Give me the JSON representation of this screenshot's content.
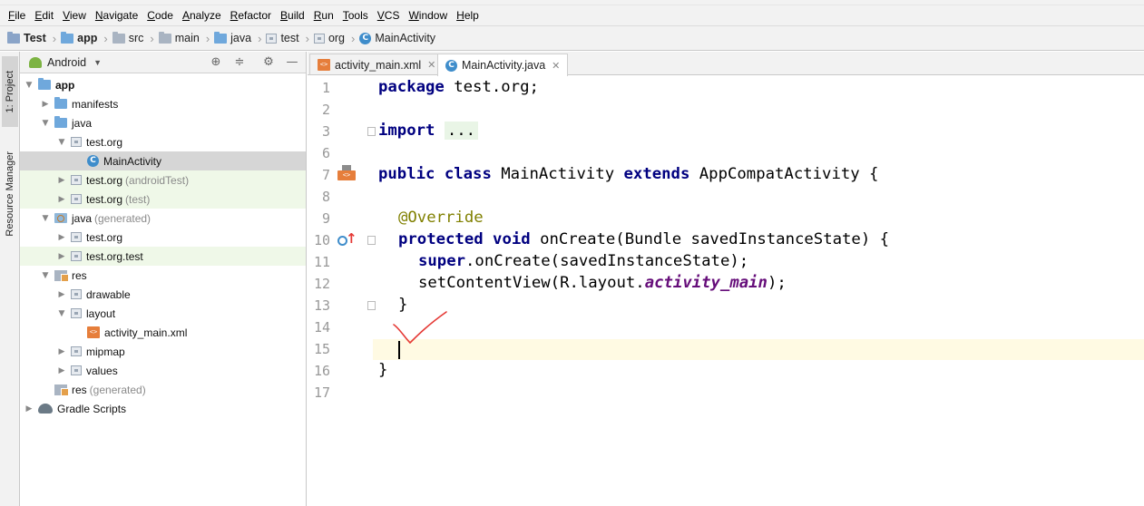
{
  "menu": [
    "File",
    "Edit",
    "View",
    "Navigate",
    "Code",
    "Analyze",
    "Refactor",
    "Build",
    "Run",
    "Tools",
    "VCS",
    "Window",
    "Help"
  ],
  "breadcrumb": [
    {
      "label": "Test",
      "icon": "project-folder-icon",
      "bold": true
    },
    {
      "label": "app",
      "icon": "module-folder-icon",
      "bold": true
    },
    {
      "label": "src",
      "icon": "folder-icon"
    },
    {
      "label": "main",
      "icon": "folder-icon"
    },
    {
      "label": "java",
      "icon": "source-folder-icon"
    },
    {
      "label": "test",
      "icon": "package-icon"
    },
    {
      "label": "org",
      "icon": "package-icon"
    },
    {
      "label": "MainActivity",
      "icon": "class-icon"
    }
  ],
  "side_tabs": {
    "project": "1: Project",
    "resources": "Resource Manager"
  },
  "project_panel": {
    "view_mode": "Android",
    "tree": [
      {
        "label": "app",
        "depth": 0,
        "arrow": "▼",
        "icon": "module",
        "bold": true
      },
      {
        "label": "manifests",
        "depth": 1,
        "arrow": "▶",
        "icon": "folder"
      },
      {
        "label": "java",
        "depth": 1,
        "arrow": "▼",
        "icon": "folder"
      },
      {
        "label": "test.org",
        "depth": 2,
        "arrow": "▼",
        "icon": "package"
      },
      {
        "label": "MainActivity",
        "depth": 3,
        "arrow": "",
        "icon": "class",
        "selected": true
      },
      {
        "label": "test.org",
        "suffix": "(androidTest)",
        "depth": 2,
        "arrow": "▶",
        "icon": "package",
        "green": true
      },
      {
        "label": "test.org",
        "suffix": "(test)",
        "depth": 2,
        "arrow": "▶",
        "icon": "package",
        "green": true
      },
      {
        "label": "java",
        "suffix": "(generated)",
        "depth": 1,
        "arrow": "▼",
        "icon": "generated"
      },
      {
        "label": "test.org",
        "depth": 2,
        "arrow": "▶",
        "icon": "package"
      },
      {
        "label": "test.org.test",
        "depth": 2,
        "arrow": "▶",
        "icon": "package",
        "green": true
      },
      {
        "label": "res",
        "depth": 1,
        "arrow": "▼",
        "icon": "res"
      },
      {
        "label": "drawable",
        "depth": 2,
        "arrow": "▶",
        "icon": "package"
      },
      {
        "label": "layout",
        "depth": 2,
        "arrow": "▼",
        "icon": "package"
      },
      {
        "label": "activity_main.xml",
        "depth": 3,
        "arrow": "",
        "icon": "xml"
      },
      {
        "label": "mipmap",
        "depth": 2,
        "arrow": "▶",
        "icon": "package"
      },
      {
        "label": "values",
        "depth": 2,
        "arrow": "▶",
        "icon": "package"
      },
      {
        "label": "res",
        "suffix": "(generated)",
        "depth": 1,
        "arrow": "",
        "icon": "res"
      },
      {
        "label": "Gradle Scripts",
        "depth": 0,
        "arrow": "▶",
        "icon": "gradle"
      }
    ]
  },
  "tabs": [
    {
      "label": "activity_main.xml",
      "close": "✕",
      "active": false
    },
    {
      "label": "MainActivity.java",
      "close": "✕",
      "active": true
    }
  ],
  "editor": {
    "line_numbers": [
      "1",
      "2",
      "3",
      "6",
      "7",
      "8",
      "9",
      "10",
      "11",
      "12",
      "13",
      "14",
      "15",
      "16",
      "17"
    ],
    "code": {
      "l1_kw": "package",
      "l1_rest": " test.org;",
      "l3_kw": "import",
      "l3_fold": "...",
      "l7_kw1": "public class",
      "l7_mid": " MainActivity ",
      "l7_kw2": "extends",
      "l7_rest": " AppCompatActivity {",
      "l9_ann": "@Override",
      "l10_kw": "protected void",
      "l10_rest": " onCreate(Bundle savedInstanceState) {",
      "l11_kw": "super",
      "l11_rest": ".onCreate(savedInstanceState);",
      "l12_a": "setContentView(R.layout.",
      "l12_ital": "activity_main",
      "l12_b": ");",
      "l13": "}",
      "l16": "}"
    }
  },
  "colors": {
    "keyword": "#000080",
    "annotation": "#808000",
    "field": "#660e7a",
    "caret_line": "#fffae3",
    "hand_check": "#e53935"
  }
}
